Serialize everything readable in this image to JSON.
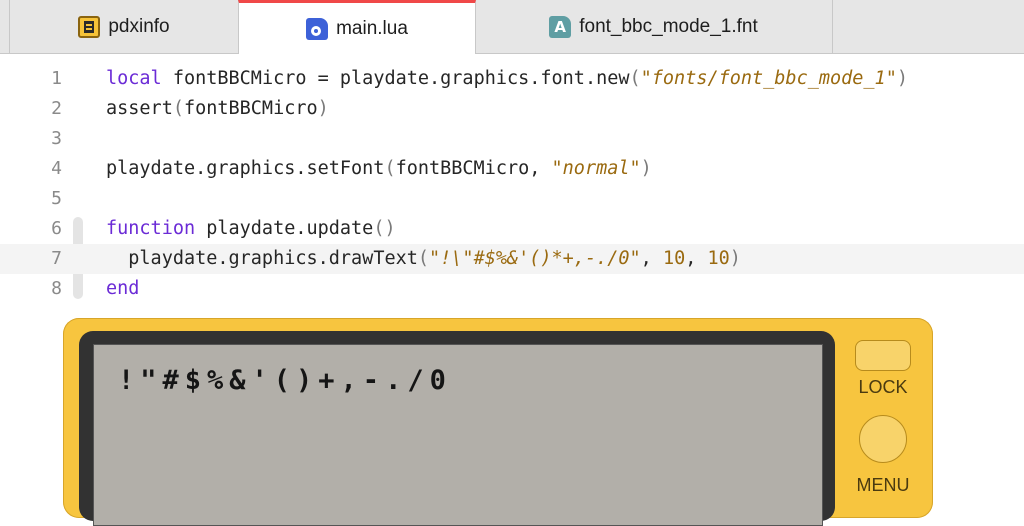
{
  "tabs": [
    {
      "label": "pdxinfo",
      "icon": "pdxinfo-file-icon",
      "active": false
    },
    {
      "label": "main.lua",
      "icon": "lua-file-icon",
      "active": true
    },
    {
      "label": "font_bbc_mode_1.fnt",
      "icon": "font-file-icon",
      "active": false
    }
  ],
  "font_icon_letter": "A",
  "editor": {
    "line_numbers": [
      "1",
      "2",
      "3",
      "4",
      "5",
      "6",
      "7",
      "8"
    ],
    "lines": {
      "l1": {
        "kw": "local",
        "code": " fontBBCMicro = playdate.graphics.font.new",
        "p_open": "(",
        "q1": "\"",
        "str": "fonts/font_bbc_mode_1",
        "q2": "\"",
        "p_close": ")"
      },
      "l2": {
        "code": "assert",
        "p_open": "(",
        "arg": "fontBBCMicro",
        "p_close": ")"
      },
      "l4": {
        "code": "playdate.graphics.setFont",
        "p_open": "(",
        "arg": "fontBBCMicro, ",
        "q1": "\"",
        "str": "normal",
        "q2": "\"",
        "p_close": ")"
      },
      "l6": {
        "kw": "function",
        "code": " playdate.update",
        "parens": "()"
      },
      "l7": {
        "indent": "  ",
        "code": "playdate.graphics.drawText",
        "p_open": "(",
        "q1": "\"",
        "str": "!\\\"#$%&'()*+,-./0",
        "q2": "\"",
        "sep1": ", ",
        "n1": "10",
        "sep2": ", ",
        "n2": "10",
        "p_close": ")"
      },
      "l8": {
        "kw": "end"
      }
    },
    "current_line": 7
  },
  "simulator": {
    "screen_text": "!\"#$%&'()+,-./0",
    "lock_label": "LOCK",
    "menu_label": "MENU"
  },
  "colors": {
    "keyword": "#6b2bd6",
    "string": "#9a6a10",
    "active_tab_accent": "#f04848",
    "simulator_body": "#f7c53f",
    "screen": "#b2afa9"
  }
}
